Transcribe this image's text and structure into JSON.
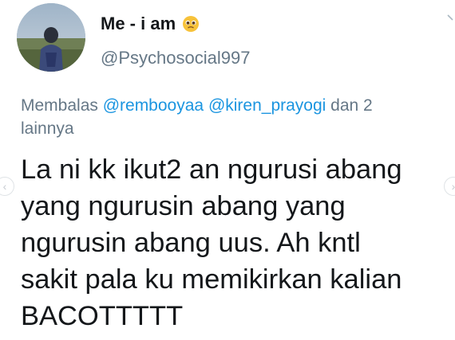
{
  "user": {
    "display_name": "Me - i am",
    "emoji_icon": "pleading-face-icon",
    "handle": "@Psychosocial997"
  },
  "reply": {
    "prefix": "Membalas ",
    "mention_1": "@rembooyaa",
    "mention_2": "@kiren_prayogi",
    "suffix_line1": " dan 2",
    "suffix_line2": "lainnya"
  },
  "tweet": {
    "lines": [
      "La ni kk ikut2 an ngurusi abang",
      "yang ngurusin abang yang",
      "ngurusin abang uus. Ah kntl",
      "sakit pala ku memikirkan kalian",
      "BACOTTTTT"
    ]
  },
  "nav": {
    "left_icon": "chevron-left-icon",
    "right_icon": "chevron-right-icon",
    "left_glyph": "‹",
    "right_glyph": "›"
  },
  "colors": {
    "text": "#14171a",
    "muted": "#657786",
    "link": "#1b95e0"
  }
}
